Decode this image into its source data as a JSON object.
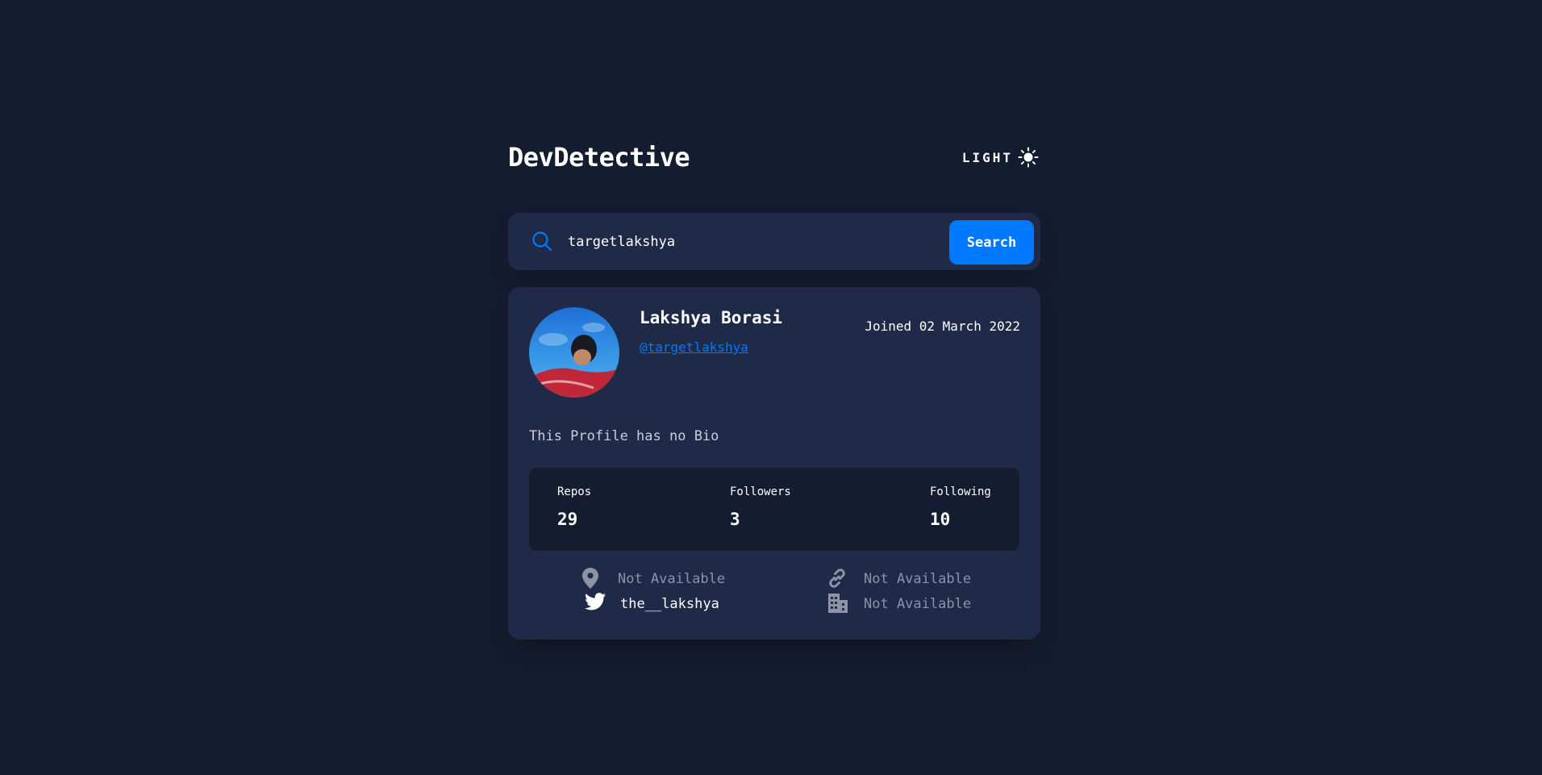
{
  "header": {
    "logo": "DevDetective",
    "theme_label": "LIGHT",
    "theme_icon": "sun-icon"
  },
  "search": {
    "value": "targetlakshya",
    "button_label": "Search",
    "icon": "search-icon"
  },
  "profile": {
    "name": "Lakshya Borasi",
    "login": "@targetlakshya",
    "joined": "Joined 02 March 2022",
    "bio": "This Profile has no Bio",
    "stats": {
      "repos_label": "Repos",
      "repos": "29",
      "followers_label": "Followers",
      "followers": "3",
      "following_label": "Following",
      "following": "10"
    },
    "links": {
      "location": "Not Available",
      "website": "Not Available",
      "twitter": "the__lakshya",
      "company": "Not Available"
    }
  },
  "colors": {
    "background": "#141d2f",
    "card": "#1e2a47",
    "accent": "#0079ff",
    "muted": "#8b93a4"
  }
}
